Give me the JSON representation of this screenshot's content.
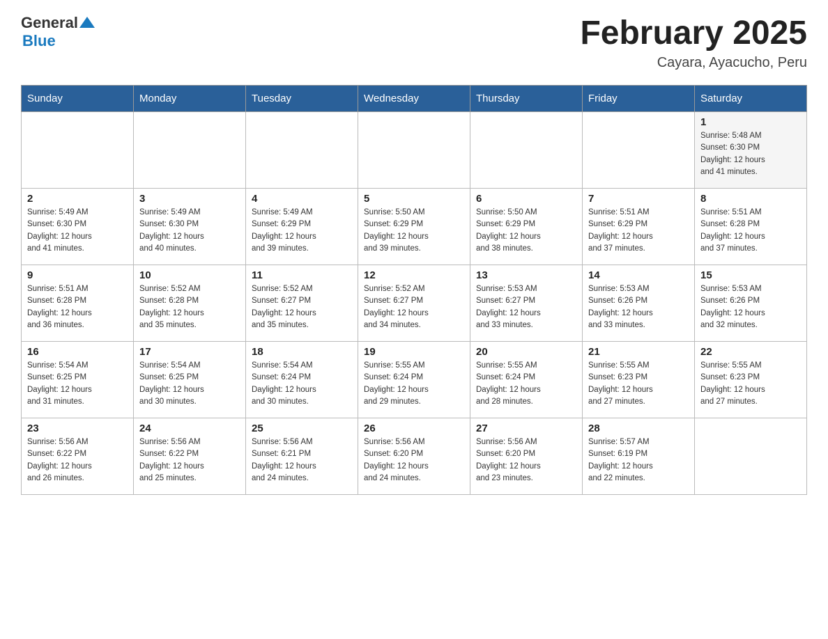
{
  "header": {
    "logo_general": "General",
    "logo_blue": "Blue",
    "month_title": "February 2025",
    "location": "Cayara, Ayacucho, Peru"
  },
  "weekdays": [
    "Sunday",
    "Monday",
    "Tuesday",
    "Wednesday",
    "Thursday",
    "Friday",
    "Saturday"
  ],
  "weeks": [
    [
      {
        "day": "",
        "info": ""
      },
      {
        "day": "",
        "info": ""
      },
      {
        "day": "",
        "info": ""
      },
      {
        "day": "",
        "info": ""
      },
      {
        "day": "",
        "info": ""
      },
      {
        "day": "",
        "info": ""
      },
      {
        "day": "1",
        "info": "Sunrise: 5:48 AM\nSunset: 6:30 PM\nDaylight: 12 hours\nand 41 minutes."
      }
    ],
    [
      {
        "day": "2",
        "info": "Sunrise: 5:49 AM\nSunset: 6:30 PM\nDaylight: 12 hours\nand 41 minutes."
      },
      {
        "day": "3",
        "info": "Sunrise: 5:49 AM\nSunset: 6:30 PM\nDaylight: 12 hours\nand 40 minutes."
      },
      {
        "day": "4",
        "info": "Sunrise: 5:49 AM\nSunset: 6:29 PM\nDaylight: 12 hours\nand 39 minutes."
      },
      {
        "day": "5",
        "info": "Sunrise: 5:50 AM\nSunset: 6:29 PM\nDaylight: 12 hours\nand 39 minutes."
      },
      {
        "day": "6",
        "info": "Sunrise: 5:50 AM\nSunset: 6:29 PM\nDaylight: 12 hours\nand 38 minutes."
      },
      {
        "day": "7",
        "info": "Sunrise: 5:51 AM\nSunset: 6:29 PM\nDaylight: 12 hours\nand 37 minutes."
      },
      {
        "day": "8",
        "info": "Sunrise: 5:51 AM\nSunset: 6:28 PM\nDaylight: 12 hours\nand 37 minutes."
      }
    ],
    [
      {
        "day": "9",
        "info": "Sunrise: 5:51 AM\nSunset: 6:28 PM\nDaylight: 12 hours\nand 36 minutes."
      },
      {
        "day": "10",
        "info": "Sunrise: 5:52 AM\nSunset: 6:28 PM\nDaylight: 12 hours\nand 35 minutes."
      },
      {
        "day": "11",
        "info": "Sunrise: 5:52 AM\nSunset: 6:27 PM\nDaylight: 12 hours\nand 35 minutes."
      },
      {
        "day": "12",
        "info": "Sunrise: 5:52 AM\nSunset: 6:27 PM\nDaylight: 12 hours\nand 34 minutes."
      },
      {
        "day": "13",
        "info": "Sunrise: 5:53 AM\nSunset: 6:27 PM\nDaylight: 12 hours\nand 33 minutes."
      },
      {
        "day": "14",
        "info": "Sunrise: 5:53 AM\nSunset: 6:26 PM\nDaylight: 12 hours\nand 33 minutes."
      },
      {
        "day": "15",
        "info": "Sunrise: 5:53 AM\nSunset: 6:26 PM\nDaylight: 12 hours\nand 32 minutes."
      }
    ],
    [
      {
        "day": "16",
        "info": "Sunrise: 5:54 AM\nSunset: 6:25 PM\nDaylight: 12 hours\nand 31 minutes."
      },
      {
        "day": "17",
        "info": "Sunrise: 5:54 AM\nSunset: 6:25 PM\nDaylight: 12 hours\nand 30 minutes."
      },
      {
        "day": "18",
        "info": "Sunrise: 5:54 AM\nSunset: 6:24 PM\nDaylight: 12 hours\nand 30 minutes."
      },
      {
        "day": "19",
        "info": "Sunrise: 5:55 AM\nSunset: 6:24 PM\nDaylight: 12 hours\nand 29 minutes."
      },
      {
        "day": "20",
        "info": "Sunrise: 5:55 AM\nSunset: 6:24 PM\nDaylight: 12 hours\nand 28 minutes."
      },
      {
        "day": "21",
        "info": "Sunrise: 5:55 AM\nSunset: 6:23 PM\nDaylight: 12 hours\nand 27 minutes."
      },
      {
        "day": "22",
        "info": "Sunrise: 5:55 AM\nSunset: 6:23 PM\nDaylight: 12 hours\nand 27 minutes."
      }
    ],
    [
      {
        "day": "23",
        "info": "Sunrise: 5:56 AM\nSunset: 6:22 PM\nDaylight: 12 hours\nand 26 minutes."
      },
      {
        "day": "24",
        "info": "Sunrise: 5:56 AM\nSunset: 6:22 PM\nDaylight: 12 hours\nand 25 minutes."
      },
      {
        "day": "25",
        "info": "Sunrise: 5:56 AM\nSunset: 6:21 PM\nDaylight: 12 hours\nand 24 minutes."
      },
      {
        "day": "26",
        "info": "Sunrise: 5:56 AM\nSunset: 6:20 PM\nDaylight: 12 hours\nand 24 minutes."
      },
      {
        "day": "27",
        "info": "Sunrise: 5:56 AM\nSunset: 6:20 PM\nDaylight: 12 hours\nand 23 minutes."
      },
      {
        "day": "28",
        "info": "Sunrise: 5:57 AM\nSunset: 6:19 PM\nDaylight: 12 hours\nand 22 minutes."
      },
      {
        "day": "",
        "info": ""
      }
    ]
  ]
}
